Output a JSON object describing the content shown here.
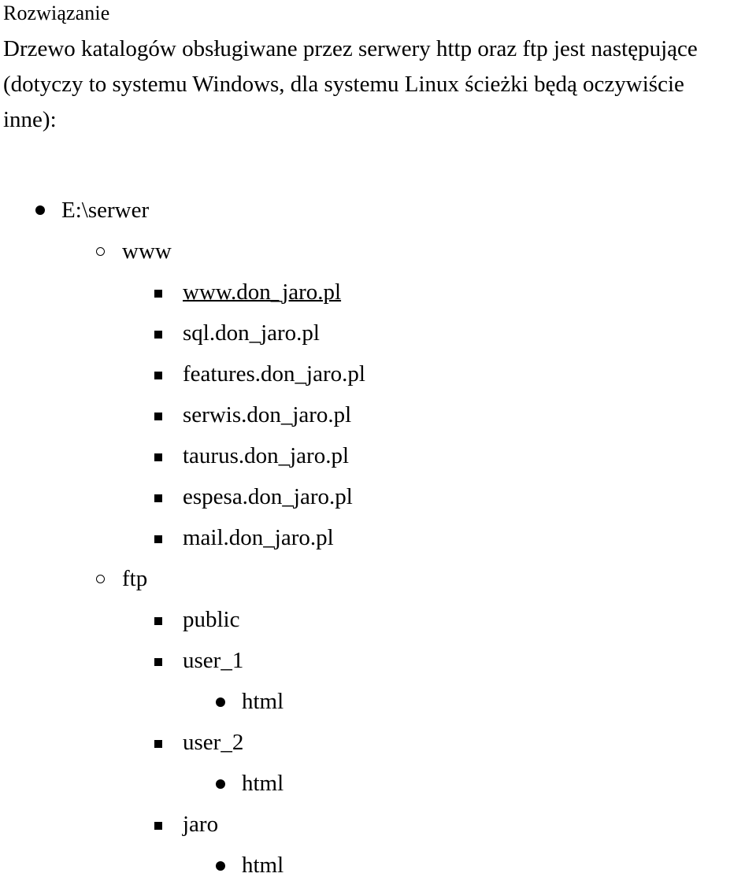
{
  "document": {
    "heading": "Rozwiązanie",
    "paragraph_lines": [
      "Drzewo katalogów obsługiwane przez serwery http oraz ftp jest następujące",
      "(dotyczy to systemu Windows, dla systemu Linux ścieżki będą oczywiście",
      "inne):"
    ]
  },
  "colors": {
    "text": "#000000",
    "hyperlink": "#0000ff",
    "background": "#ffffff"
  },
  "bullets": {
    "level1": "filled-disc",
    "level2": "hollow-circle",
    "level3": "filled-square",
    "level4": "filled-disc"
  },
  "tree": {
    "root": "E:\\serwer",
    "www_folder": "www",
    "www_sites": [
      "www.don_jaro.pl",
      "sql.don_jaro.pl",
      "features.don_jaro.pl",
      "serwis.don_jaro.pl",
      "taurus.don_jaro.pl",
      "espesa.don_jaro.pl",
      "mail.don_jaro.pl"
    ],
    "ftp_folder": "ftp",
    "ftp_public": "public",
    "ftp_user_1": "user_1",
    "ftp_user_1_html": "html",
    "ftp_user_2": "user_2",
    "ftp_user_2_html": "html",
    "ftp_jaro": "jaro",
    "ftp_jaro_html": "html"
  }
}
